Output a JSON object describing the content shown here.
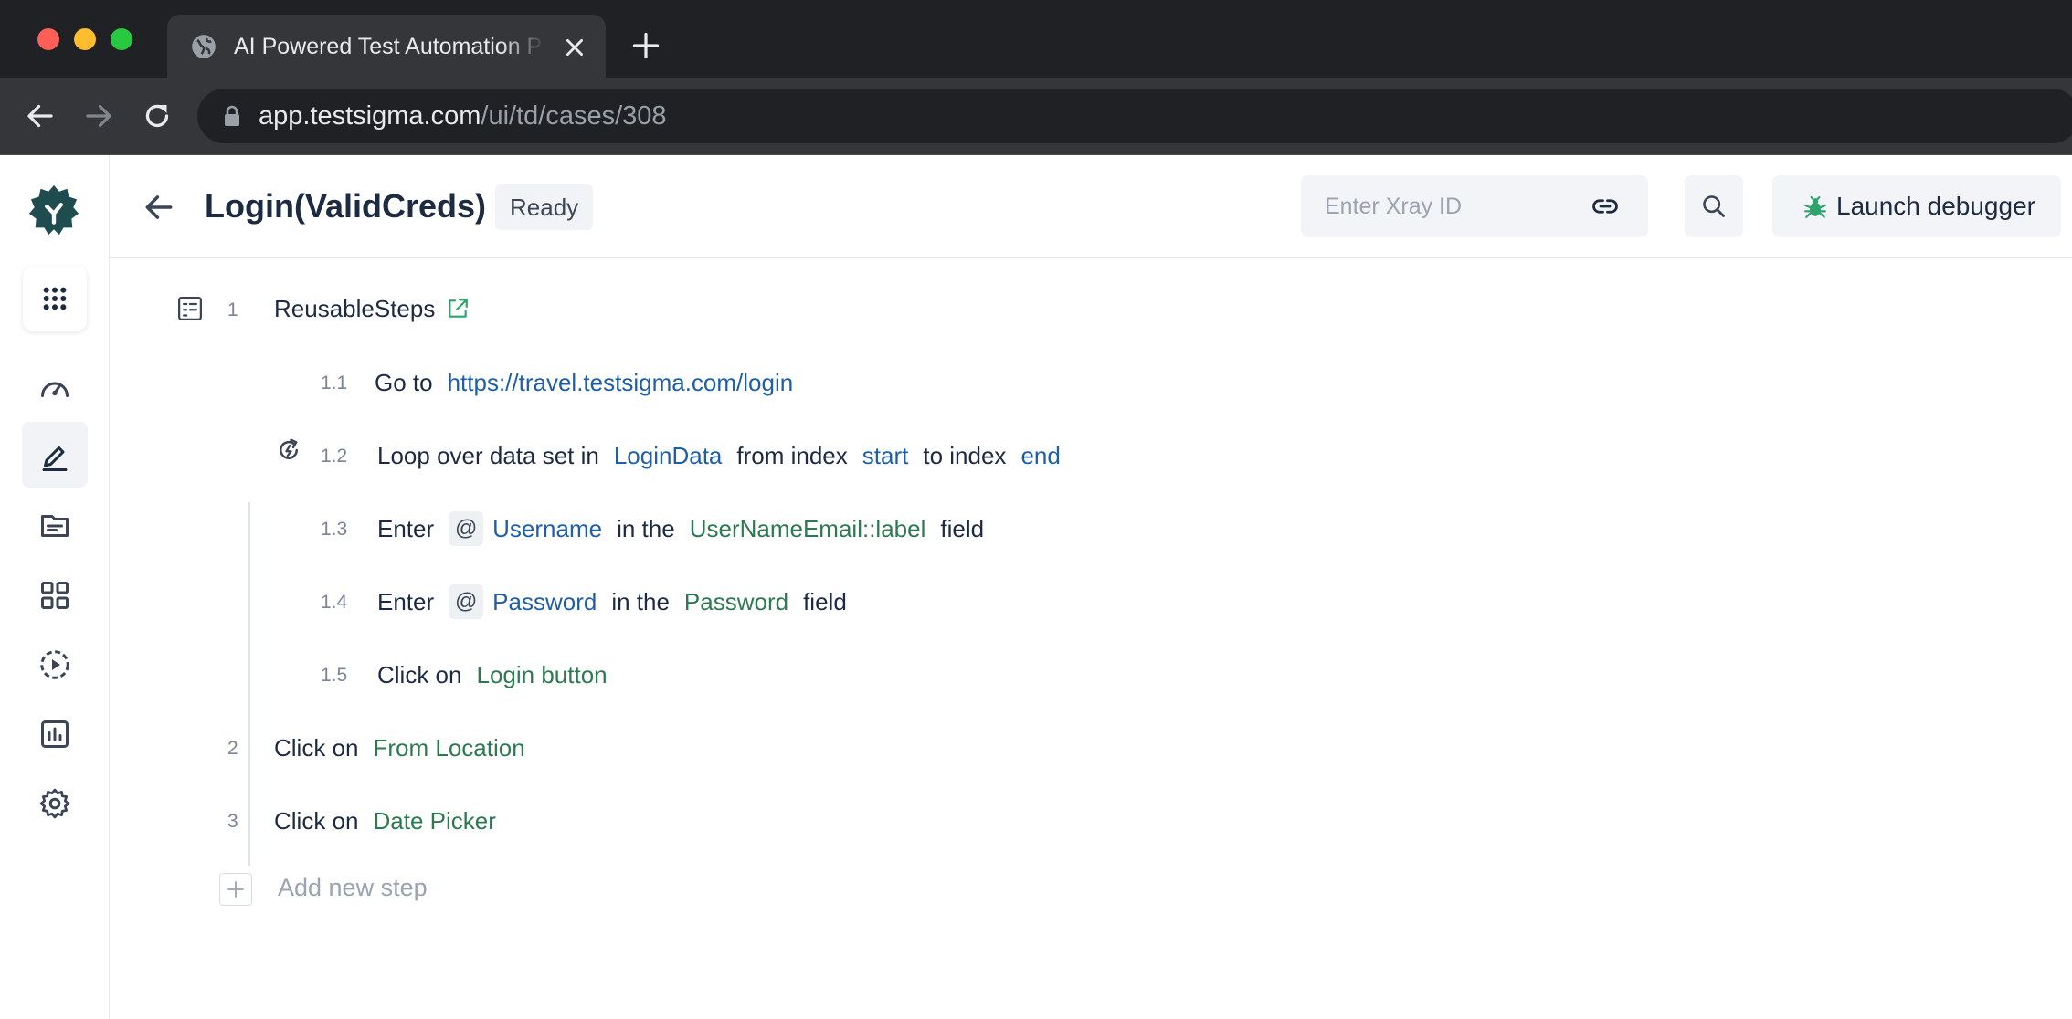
{
  "browser": {
    "tab_title": "AI Powered Test Automation Platform",
    "url_host": "app.testsigma.com",
    "url_path": "/ui/td/cases/308"
  },
  "header": {
    "title": "Login(ValidCreds)",
    "status": "Ready",
    "xray_placeholder": "Enter Xray ID",
    "debugger_label": "Launch debugger"
  },
  "steps": {
    "s1": {
      "num": "1",
      "label": "ReusableSteps"
    },
    "s1_1": {
      "num": "1.1",
      "kw1": "Go to",
      "link": "https://travel.testsigma.com/login"
    },
    "s1_2": {
      "num": "1.2",
      "kw1": "Loop over data set in",
      "dataset": "LoginData",
      "kw2": "from index",
      "start": "start",
      "kw3": "to index",
      "end": "end"
    },
    "s1_3": {
      "num": "1.3",
      "kw1": "Enter",
      "at": "@",
      "param": "Username",
      "kw2": "in the",
      "element": "UserNameEmail::label",
      "kw3": "field"
    },
    "s1_4": {
      "num": "1.4",
      "kw1": "Enter",
      "at": "@",
      "param": "Password",
      "kw2": "in the",
      "element": "Password",
      "kw3": "field"
    },
    "s1_5": {
      "num": "1.5",
      "kw1": "Click on",
      "element": "Login button"
    },
    "s2": {
      "num": "2",
      "kw1": "Click on",
      "element": "From Location"
    },
    "s3": {
      "num": "3",
      "kw1": "Click on",
      "element": "Date Picker"
    }
  },
  "add_step_label": "Add new step",
  "icons": {
    "sidebar": [
      "apps-grid-icon",
      "dashboard-icon",
      "edit-icon",
      "folder-icon",
      "modules-icon",
      "run-icon",
      "reports-icon",
      "settings-icon"
    ],
    "debugger": "bug-icon"
  },
  "colors": {
    "brand": "#1f4d4f",
    "element_token": "#2d7a51",
    "data_token": "#1f5fa8",
    "debugger_icon": "#2ea36b"
  }
}
